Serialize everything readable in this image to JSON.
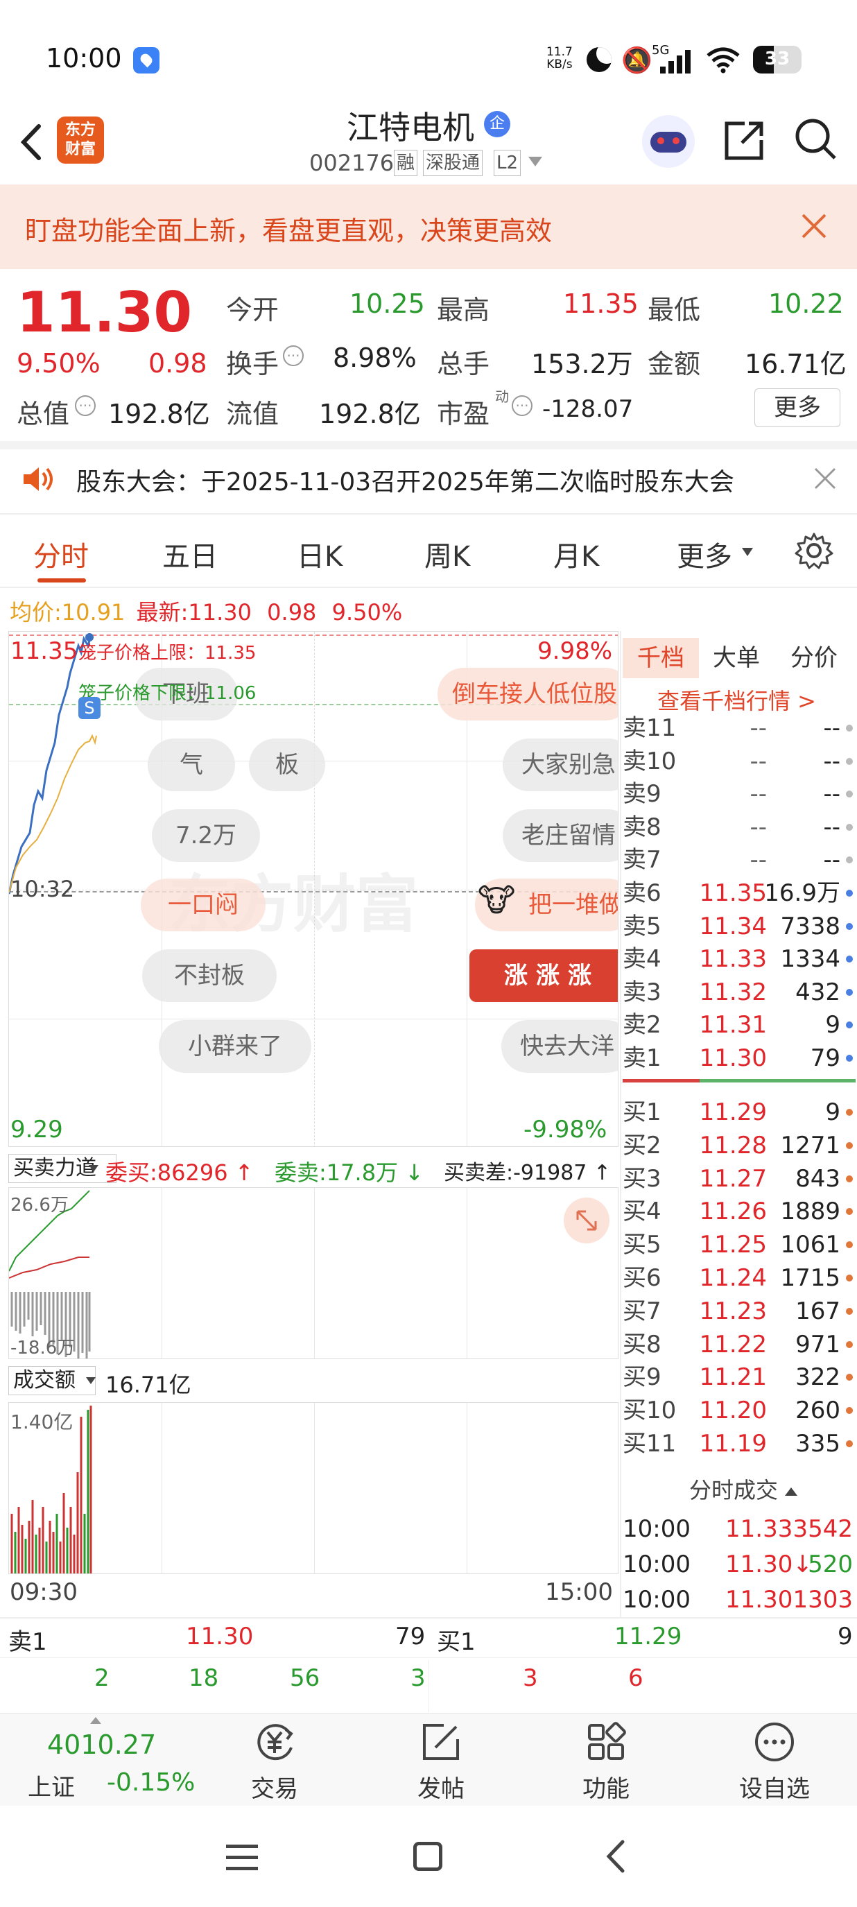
{
  "status_bar": {
    "time": "10:00",
    "net_speed_top": "11.7",
    "net_speed_bottom": "KB/s",
    "signal": "5G",
    "battery": "33"
  },
  "header": {
    "logo_line1": "东方",
    "logo_line2": "财富",
    "stock_name": "江特电机",
    "enterprise_badge": "企",
    "stock_code": "002176",
    "tags": [
      "融",
      "深股通",
      "L2"
    ]
  },
  "banner": {
    "text": "盯盘功能全面上新，看盘更直观，决策更高效"
  },
  "quote": {
    "price": "11.30",
    "pct": "9.50%",
    "change": "0.98",
    "open_label": "今开",
    "open": "10.25",
    "high_label": "最高",
    "high": "11.35",
    "low_label": "最低",
    "low": "10.22",
    "turnover_label": "换手",
    "turnover": "8.98%",
    "volume_label": "总手",
    "volume": "153.2万",
    "amount_label": "金额",
    "amount": "16.71亿",
    "mktcap_label": "总值",
    "mktcap": "192.8亿",
    "float_label": "流值",
    "float": "192.8亿",
    "pe_label": "市盈",
    "pe_sup": "动",
    "pe": "-128.07",
    "more_button": "更多"
  },
  "notice": {
    "text": "股东大会：于2025-11-03召开2025年第二次临时股东大会"
  },
  "tabs": [
    "分时",
    "五日",
    "日K",
    "周K",
    "月K",
    "更多"
  ],
  "chart_info": {
    "avg_label": "均价:",
    "avg": "10.91",
    "latest_label": "最新:",
    "latest": "11.30",
    "change": "0.98",
    "pct": "9.50%"
  },
  "chart": {
    "y_top": "11.35",
    "y_top_pct": "9.98%",
    "y_bottom": "9.29",
    "y_bottom_pct": "-9.98%",
    "cage_upper": "笼子价格上限：11.35",
    "cage_lower": "笼子价格下限：11.06",
    "time_marker": "10:32",
    "x_start": "09:30",
    "x_end": "15:00",
    "chips": [
      "下班",
      "倒车接人低位股",
      "气",
      "板",
      "大家别急",
      "7.2万",
      "老庄留情",
      "一口闷",
      "把一堆做",
      "不封板",
      "涨涨涨",
      "小群来了",
      "快去大洋"
    ],
    "s_badge": "S"
  },
  "force": {
    "selector": "买卖力道",
    "buy_label": "委买:",
    "buy": "86296",
    "sell_label": "委卖:",
    "sell": "17.8万",
    "diff_label": "买卖差:",
    "diff": "-91987",
    "top": "26.6万",
    "bottom": "-18.6万"
  },
  "amount_panel": {
    "selector": "成交额",
    "value": "16.71亿",
    "top": "1.40亿"
  },
  "orderbook": {
    "tabs": [
      "千档",
      "大单",
      "分价"
    ],
    "link": "查看千档行情 >",
    "asks": [
      {
        "label": "卖11",
        "price": "--",
        "vol": "--"
      },
      {
        "label": "卖10",
        "price": "--",
        "vol": "--"
      },
      {
        "label": "卖9",
        "price": "--",
        "vol": "--"
      },
      {
        "label": "卖8",
        "price": "--",
        "vol": "--"
      },
      {
        "label": "卖7",
        "price": "--",
        "vol": "--"
      },
      {
        "label": "卖6",
        "price": "11.35",
        "vol": "16.9万"
      },
      {
        "label": "卖5",
        "price": "11.34",
        "vol": "7338"
      },
      {
        "label": "卖4",
        "price": "11.33",
        "vol": "1334"
      },
      {
        "label": "卖3",
        "price": "11.32",
        "vol": "432"
      },
      {
        "label": "卖2",
        "price": "11.31",
        "vol": "9"
      },
      {
        "label": "卖1",
        "price": "11.30",
        "vol": "79"
      }
    ],
    "bids": [
      {
        "label": "买1",
        "price": "11.29",
        "vol": "9"
      },
      {
        "label": "买2",
        "price": "11.28",
        "vol": "1271"
      },
      {
        "label": "买3",
        "price": "11.27",
        "vol": "843"
      },
      {
        "label": "买4",
        "price": "11.26",
        "vol": "1889"
      },
      {
        "label": "买5",
        "price": "11.25",
        "vol": "1061"
      },
      {
        "label": "买6",
        "price": "11.24",
        "vol": "1715"
      },
      {
        "label": "买7",
        "price": "11.23",
        "vol": "167"
      },
      {
        "label": "买8",
        "price": "11.22",
        "vol": "971"
      },
      {
        "label": "买9",
        "price": "11.21",
        "vol": "322"
      },
      {
        "label": "买10",
        "price": "11.20",
        "vol": "260"
      },
      {
        "label": "买11",
        "price": "11.19",
        "vol": "335"
      }
    ],
    "trades_title": "分时成交",
    "trades": [
      {
        "time": "10:00",
        "price": "11.33",
        "vol": "3542"
      },
      {
        "time": "10:00",
        "price": "11.30↓",
        "vol": "520"
      },
      {
        "time": "10:00",
        "price": "11.30",
        "vol": "1303"
      }
    ]
  },
  "bottom_queue": {
    "ask_label": "卖1",
    "ask_price": "11.30",
    "ask_vol": "79",
    "bid_label": "买1",
    "bid_price": "11.29",
    "bid_vol": "9",
    "ask_queue": [
      "2",
      "18",
      "56",
      "3"
    ],
    "bid_queue": [
      "3",
      "6"
    ]
  },
  "bottom_nav": {
    "index_value": "4010.27",
    "index_name": "上证",
    "index_pct": "-0.15%",
    "items": [
      "交易",
      "发帖",
      "功能",
      "设自选"
    ]
  }
}
